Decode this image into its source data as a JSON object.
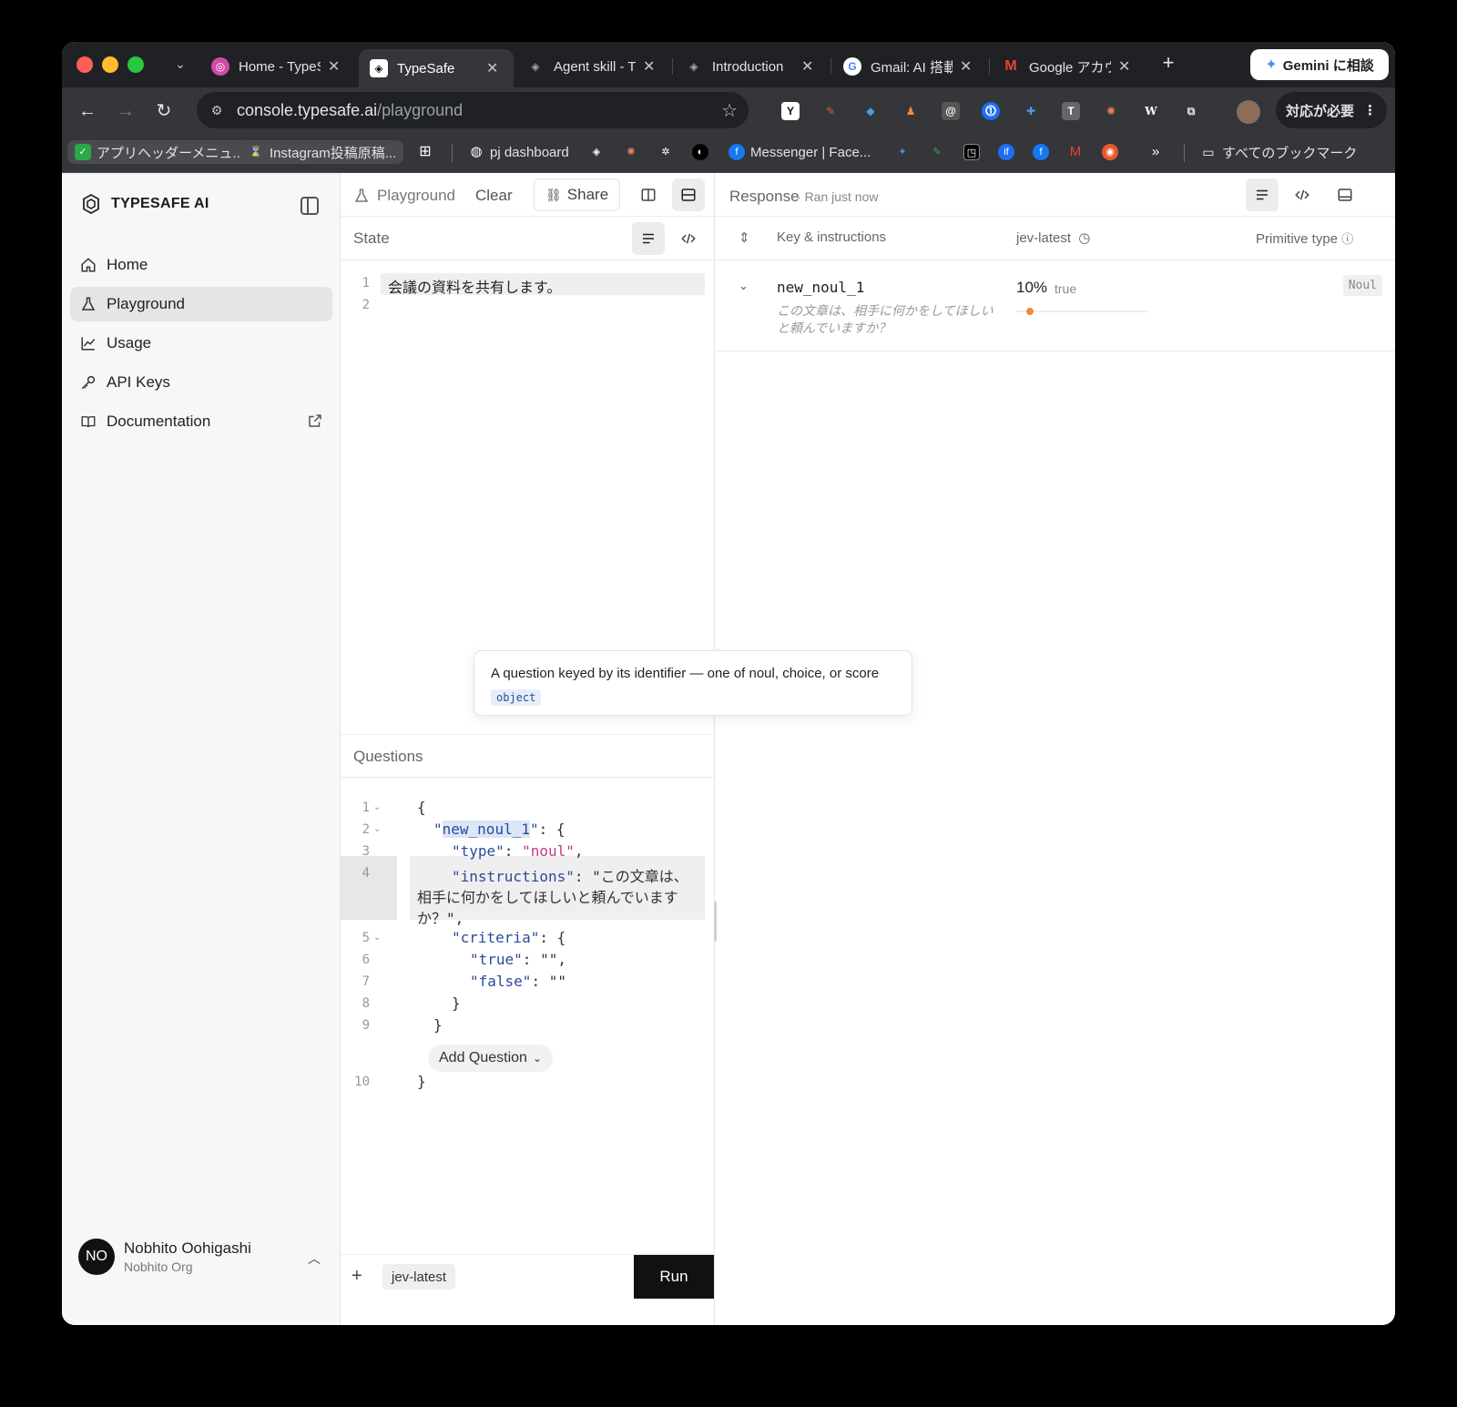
{
  "browser": {
    "tabs": [
      {
        "label": "Home - TypeSafe",
        "active": false
      },
      {
        "label": "TypeSafe",
        "active": true
      },
      {
        "label": "Agent skill - TypeSafe",
        "active": false
      },
      {
        "label": "Introduction",
        "active": false
      },
      {
        "label": "Gmail: AI 搭載",
        "active": false
      },
      {
        "label": "Google アカウント",
        "active": false
      }
    ],
    "gemini_label": "Gemini に相談",
    "url_host": "console.typesafe.ai",
    "url_path": "/playground",
    "needs_action_label": "対応が必要",
    "bookmarks": [
      "アプリヘッダーメニュ...",
      "Instagram投稿原稿...",
      "pj dashboard",
      "Messenger | Face...",
      "すべてのブックマーク"
    ]
  },
  "sidebar": {
    "brand": "TYPESAFE AI",
    "items": [
      {
        "label": "Home",
        "icon": "home-icon"
      },
      {
        "label": "Playground",
        "icon": "flask-icon"
      },
      {
        "label": "Usage",
        "icon": "chart-line-icon"
      },
      {
        "label": "API Keys",
        "icon": "key-icon"
      },
      {
        "label": "Documentation",
        "icon": "book-icon"
      }
    ],
    "user": {
      "initials": "NO",
      "name": "Nobhito Oohigashi",
      "org": "Nobhito Org"
    }
  },
  "toolbar": {
    "playground_label": "Playground",
    "clear_label": "Clear",
    "share_label": "Share"
  },
  "state": {
    "title": "State",
    "lines": [
      "会議の資料を共有します。",
      ""
    ],
    "line_numbers": [
      "1",
      "2"
    ]
  },
  "questions": {
    "title": "Questions",
    "line_numbers": [
      "1",
      "2",
      "3",
      "4",
      "5",
      "6",
      "7",
      "8",
      "9",
      "10"
    ],
    "tokens": {
      "open_brace": "{",
      "key_q": "new_noul_1",
      "key_type": "\"type\"",
      "val_type": "\"noul\"",
      "key_instr": "\"instructions\"",
      "instr_line1": "\"この文章は、",
      "instr_line2": "相手に何かをしてほしいと頼んでいます",
      "instr_line3": "か？\",",
      "key_criteria": "\"criteria\"",
      "key_true": "\"true\"",
      "key_false": "\"false\"",
      "empty_str": "\"\"",
      "close_brace": "}"
    },
    "add_question_label": "Add Question",
    "tooltip_text": "A question keyed by its identifier — one of noul, choice, or score",
    "tooltip_badge": "object"
  },
  "footer": {
    "model": "jev-latest",
    "run_label": "Run"
  },
  "response": {
    "title": "Response",
    "subtitle": "Ran just now",
    "col_key": "Key & instructions",
    "col_model": "jev-latest",
    "col_type": "Primitive type",
    "rows": [
      {
        "key": "new_noul_1",
        "instructions": "この文章は、相手に何かをしてほしいと頼んでいますか？",
        "percent": "10%",
        "percent_value": 0.1,
        "value_label": "true",
        "type": "Noul"
      }
    ]
  },
  "colors": {
    "key": "#2c4a9a",
    "string": "#c23b87",
    "accent_dot": "#f08a3c"
  }
}
